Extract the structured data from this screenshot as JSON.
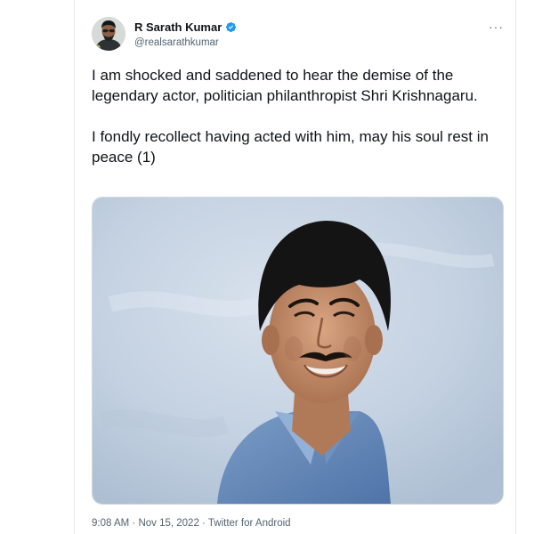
{
  "tweet": {
    "author": {
      "display_name": "R Sarath Kumar",
      "handle": "@realsarathkumar",
      "verified": true
    },
    "more_label": "···",
    "paragraphs": [
      "I am shocked and saddened to hear the demise of the legendary actor, politician philanthropist Shri Krishnagaru.",
      "I fondly recollect having acted with him, may his soul rest in peace (1)"
    ],
    "meta": {
      "time": "9:08 AM",
      "sep1": " · ",
      "date": "Nov 15, 2022",
      "sep2": " · ",
      "source": "Twitter for Android"
    }
  },
  "colors": {
    "text": "#0f1419",
    "secondary": "#536471",
    "verified": "#1d9bf0",
    "media_background": "#c2d0e0"
  },
  "icons": {
    "verified": "verified-badge-icon",
    "more": "more-options-icon"
  }
}
